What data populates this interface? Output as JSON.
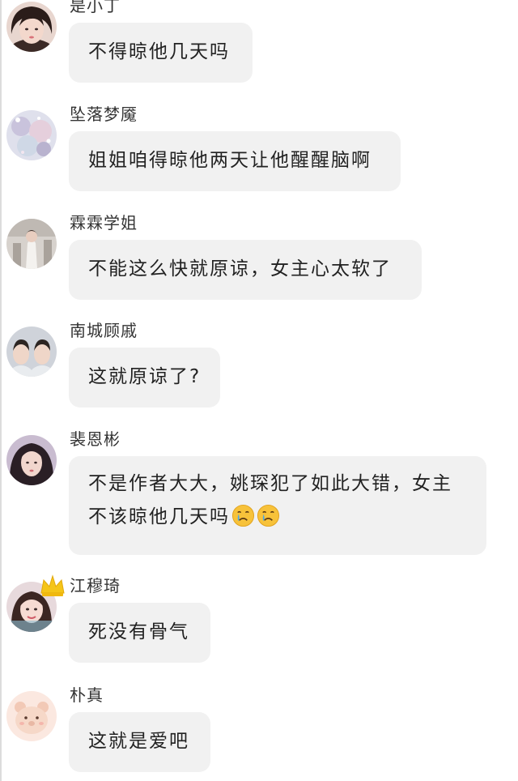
{
  "comments": [
    {
      "username": "是小丁",
      "lines": [
        "不得晾他几天吗"
      ]
    },
    {
      "username": "坠落梦魇",
      "lines": [
        "姐姐咱得晾他两天让他醒醒脑啊"
      ]
    },
    {
      "username": "霖霖学姐",
      "lines": [
        "不能这么快就原谅，女主心太软了"
      ]
    },
    {
      "username": "南城顾戚",
      "lines": [
        "这就原谅了?"
      ]
    },
    {
      "username": "裴恩彬",
      "lines": [
        "不是作者大大，姚琛犯了如此大错，女主",
        "不该晾他几天吗"
      ],
      "emojis": [
        "crying-emoji",
        "crying-emoji"
      ]
    },
    {
      "username": "江穆琦",
      "lines": [
        "死没有骨气"
      ],
      "badge": "crown-icon"
    },
    {
      "username": "朴真",
      "lines": [
        "这就是爱吧"
      ]
    }
  ],
  "colors": {
    "bubble": "#f1f1f1",
    "text": "#222222",
    "username": "#333333",
    "crown": "#f5c518"
  }
}
